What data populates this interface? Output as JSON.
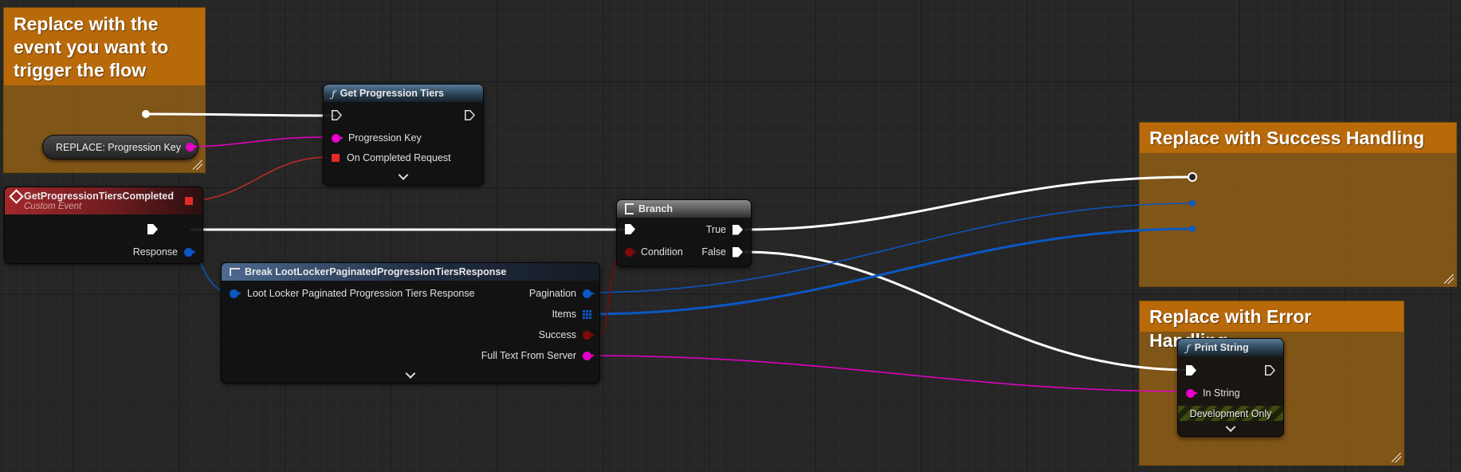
{
  "comments": {
    "trigger": "Replace with the event you want to trigger the flow",
    "success": "Replace with Success Handling",
    "error": "Replace with Error Handling"
  },
  "replace_node": {
    "label": "REPLACE: Progression Key"
  },
  "get_tiers": {
    "title": "Get Progression Tiers",
    "pin_key": "Progression Key",
    "pin_completed": "On Completed Request"
  },
  "event_node": {
    "title": "GetProgressionTiersCompleted",
    "subtitle": "Custom Event",
    "pin_response": "Response"
  },
  "branch": {
    "title": "Branch",
    "pin_true": "True",
    "pin_condition": "Condition",
    "pin_false": "False"
  },
  "break_node": {
    "title": "Break LootLockerPaginatedProgressionTiersResponse",
    "pin_input": "Loot Locker Paginated Progression Tiers Response",
    "pin_pagination": "Pagination",
    "pin_items": "Items",
    "pin_success": "Success",
    "pin_fulltext": "Full Text From Server"
  },
  "print_string": {
    "title": "Print String",
    "pin_in": "In String",
    "dev_only": "Development Only"
  },
  "colors": {
    "exec_wire": "#ffffff",
    "string_pin": "#e600c6",
    "struct_pin": "#0b57c4",
    "bool_pin": "#7e0a0a",
    "delegate_pin": "#e52a2a",
    "comment": "#b8690a"
  },
  "icons": [
    "function-icon",
    "event-icon",
    "branch-icon",
    "break-struct-icon",
    "chevron-down-icon",
    "resize-grip-icon"
  ]
}
